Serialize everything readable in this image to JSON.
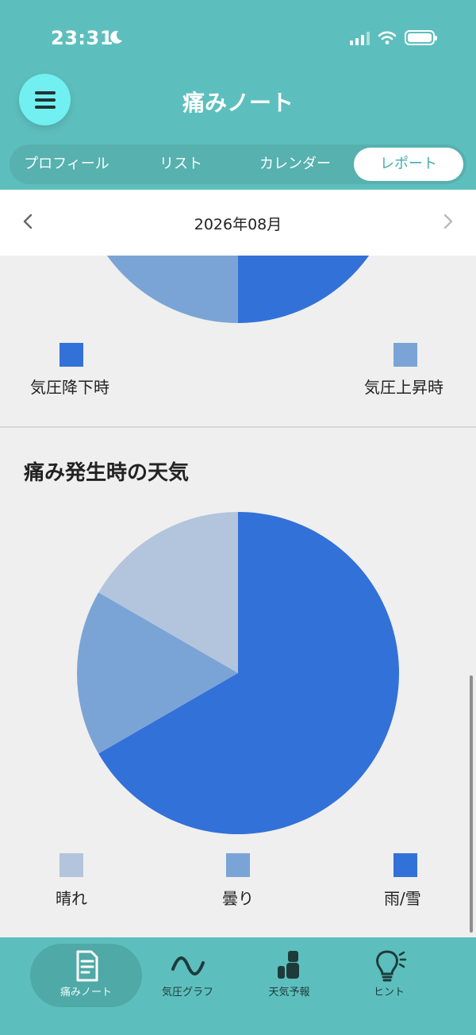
{
  "status": {
    "time": "23:31"
  },
  "header": {
    "title": "痛みノート"
  },
  "tabs": [
    {
      "label": "プロフィール"
    },
    {
      "label": "リスト"
    },
    {
      "label": "カレンダー"
    },
    {
      "label": "レポート"
    }
  ],
  "month": {
    "label": "2026年08月"
  },
  "pressure_legend": [
    {
      "label": "気圧降下時",
      "color": "#3271d8"
    },
    {
      "label": "気圧上昇時",
      "color": "#7ba4d6"
    }
  ],
  "weather_section": {
    "title": "痛み発生時の天気"
  },
  "chart_data": [
    {
      "type": "pie",
      "categories": [
        "気圧降下時",
        "気圧上昇時"
      ],
      "values": [
        50,
        50
      ],
      "colors": [
        "#3271d8",
        "#7ba4d6"
      ]
    },
    {
      "type": "pie",
      "title": "痛み発生時の天気",
      "categories": [
        "晴れ",
        "曇り",
        "雨/雪"
      ],
      "values": [
        1,
        1,
        4
      ],
      "colors": [
        "#b3c5dd",
        "#7ba4d6",
        "#3271d8"
      ]
    }
  ],
  "nav": [
    {
      "label": "痛みノート",
      "icon": "note-icon"
    },
    {
      "label": "気圧グラフ",
      "icon": "wave-icon"
    },
    {
      "label": "天気予報",
      "icon": "weather-icon"
    },
    {
      "label": "ヒント",
      "icon": "lightbulb-icon"
    }
  ]
}
